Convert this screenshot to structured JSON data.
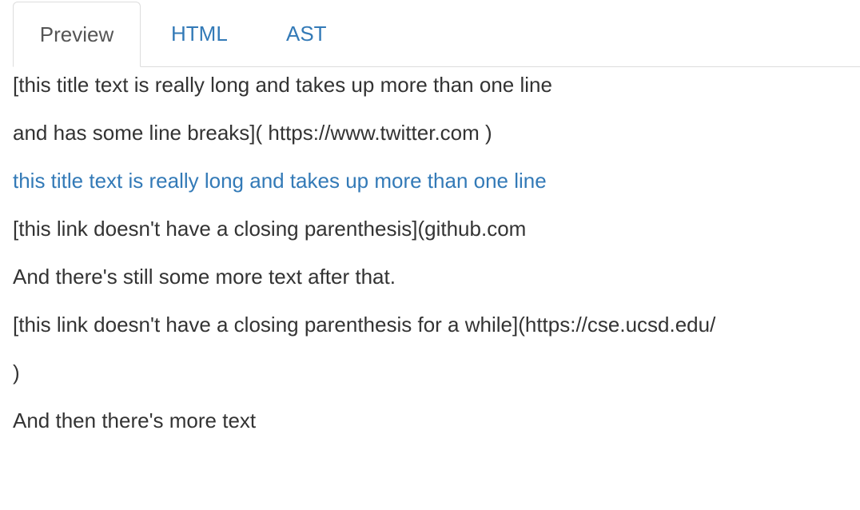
{
  "tabs": {
    "preview": "Preview",
    "html": "HTML",
    "ast": "AST"
  },
  "preview": {
    "lines": [
      "[this title text is really long and takes up more than one line",
      "and has some line breaks]( https://www.twitter.com )",
      "this title text is really long and takes up more than one line",
      "[this link doesn't have a closing parenthesis](github.com",
      "And there's still some more text after that.",
      "[this link doesn't have a closing parenthesis for a while](https://cse.ucsd.edu/",
      ")",
      "And then there's more text"
    ]
  },
  "colors": {
    "link": "#337ab7",
    "text": "#333333",
    "active_tab_text": "#555555",
    "border": "#dddddd"
  }
}
